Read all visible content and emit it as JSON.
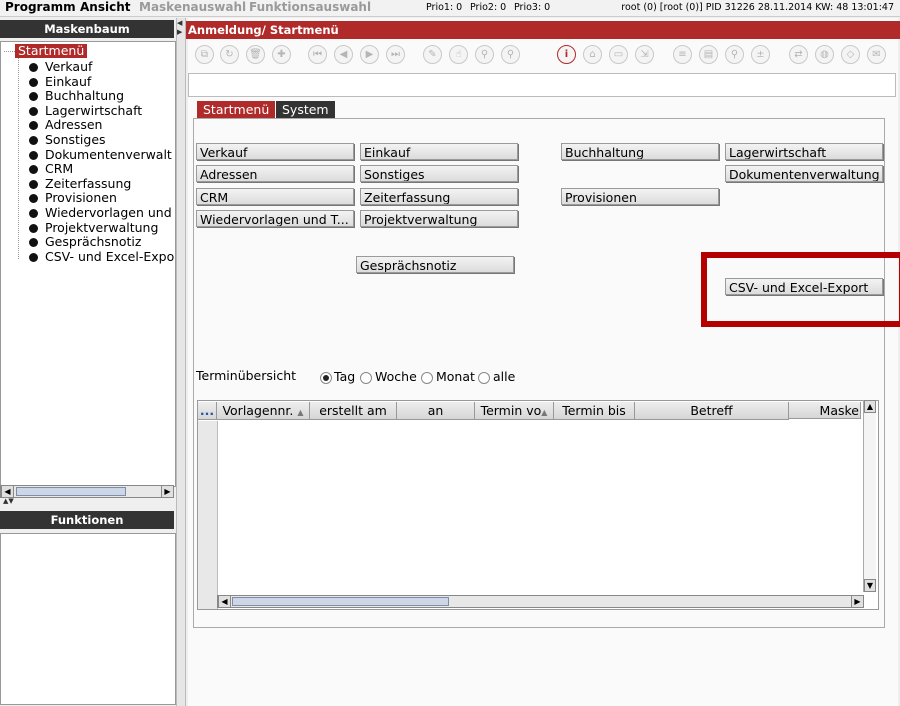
{
  "menubar": {
    "items": [
      "Programm",
      "Ansicht",
      "Maskenauswahl",
      "Funktionsauswahl"
    ],
    "prio1": "Prio1: 0",
    "prio2": "Prio2: 0",
    "prio3": "Prio3: 0",
    "status": "root (0) [root (0)] PID 31226  28.11.2014 KW: 48  13:01:47"
  },
  "left": {
    "tree_title": "Maskenbaum",
    "root": "Startmenü",
    "items": [
      "Verkauf",
      "Einkauf",
      "Buchhaltung",
      "Lagerwirtschaft",
      "Adressen",
      "Sonstiges",
      "Dokumentenverwalt",
      "CRM",
      "Zeiterfassung",
      "Provisionen",
      "Wiedervorlagen und",
      "Projektverwaltung",
      "Gesprächsnotiz",
      "CSV- und Excel-Expo"
    ],
    "functions_title": "Funktionen"
  },
  "right": {
    "title": "Anmeldung/ Startmenü",
    "tabs": [
      "Startmenü",
      "System"
    ],
    "buttons": {
      "verkauf": "Verkauf",
      "einkauf": "Einkauf",
      "buchhaltung": "Buchhaltung",
      "lagerwirtschaft": "Lagerwirtschaft",
      "adressen": "Adressen",
      "sonstiges": "Sonstiges",
      "dokumentenverwaltung": "Dokumentenverwaltung",
      "crm": "CRM",
      "zeiterfassung": "Zeiterfassung",
      "provisionen": "Provisionen",
      "wiedervorlagen": "Wiedervorlagen und T...",
      "projektverwaltung": "Projektverwaltung",
      "gespraechsnotiz": "Gesprächsnotiz",
      "csv_export": "CSV- und Excel-Export"
    },
    "termin": {
      "label": "Terminübersicht",
      "options": [
        "Tag",
        "Woche",
        "Monat",
        "alle"
      ],
      "selected": "Tag"
    },
    "table": {
      "columns": [
        "...",
        "Vorlagennr.",
        "erstellt am",
        "an",
        "Termin vo",
        "Termin bis",
        "Betreff",
        "Maske"
      ],
      "rows": []
    }
  },
  "colors": {
    "accent": "#b12a2a",
    "panel_header": "#333333",
    "highlight_box": "#b30000"
  }
}
